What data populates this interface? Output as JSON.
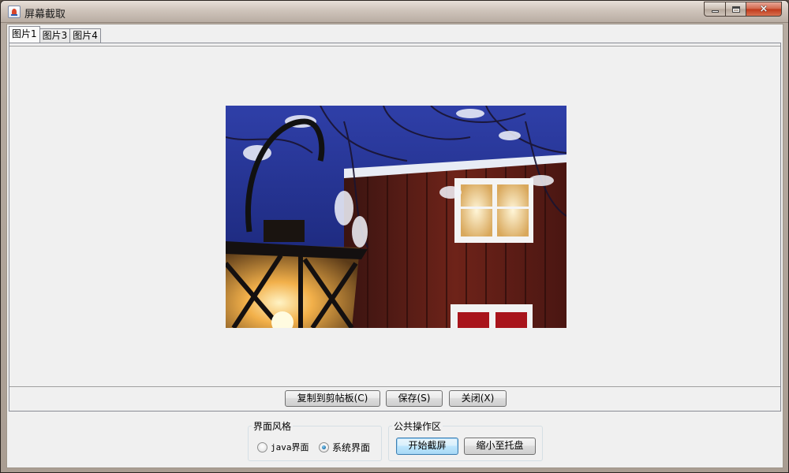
{
  "window": {
    "title": "屏幕截取",
    "controls": {
      "minimize": "minimize",
      "maximize": "maximize",
      "close": "×"
    }
  },
  "tabs": [
    {
      "label": "图片1",
      "active": true
    },
    {
      "label": "图片3",
      "active": false
    },
    {
      "label": "图片4",
      "active": false
    }
  ],
  "actions": {
    "copy_label": "复制到剪帖板(C)",
    "save_label": "保存(S)",
    "close_label": "关闭(X)"
  },
  "style_group": {
    "title": "界面风格",
    "options": [
      {
        "label": "java界面",
        "checked": false
      },
      {
        "label": "系统界面",
        "checked": true
      }
    ]
  },
  "ops_group": {
    "title": "公共操作区",
    "start_label": "开始截屏",
    "tray_label": "缩小至托盘"
  },
  "colors": {
    "accent_blue": "#3c7fb1",
    "client_bg": "#f0f0f0",
    "close_red": "#c0391b"
  }
}
